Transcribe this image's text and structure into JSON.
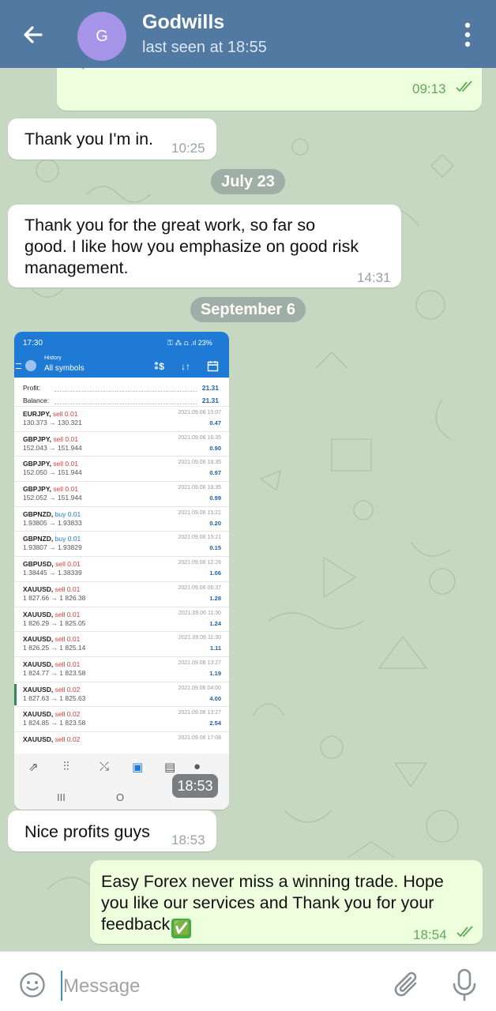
{
  "header": {
    "contact_name": "Godwills",
    "status": "last seen at 18:55",
    "avatar_initial": "G",
    "avatar_color": "#a694e8"
  },
  "messages": [
    {
      "id": "m0",
      "direction": "out",
      "text": "",
      "time": "09:13",
      "read": true
    },
    {
      "id": "m1",
      "direction": "in",
      "text": "Thank you I'm in.",
      "time": "10:25"
    },
    {
      "id": "d1",
      "type": "date",
      "text": "July 23"
    },
    {
      "id": "m2",
      "direction": "in",
      "lines": [
        "Thank you for the great work, so far so",
        "good. I like how you emphasize on good risk",
        "management."
      ],
      "time": "14:31"
    },
    {
      "id": "d2",
      "type": "date",
      "text": "September 6"
    },
    {
      "id": "m3",
      "direction": "in",
      "type": "image",
      "time": "18:53"
    },
    {
      "id": "m4",
      "direction": "in",
      "text": "Nice profits guys",
      "time": "18:53"
    },
    {
      "id": "m5",
      "direction": "out",
      "lines": [
        "Easy Forex never miss a winning trade. Hope",
        "you like our services and Thank you for your",
        "feedback"
      ],
      "emoji": "✅",
      "time": "18:54",
      "read": true
    }
  ],
  "screenshot": {
    "status_time": "17:30",
    "status_right": "⚿ ⁂ ⩍ .ıl 23%",
    "title_small": "History",
    "title": "All symbols",
    "profit_label": "Profit:",
    "profit_value": "21.31",
    "balance_label": "Balance:",
    "balance_value": "21.31",
    "trades": [
      {
        "symbol": "EURJPY,",
        "side": "sell 0.01",
        "type": "sell",
        "prices": "130.373 → 130.321",
        "date": "2021.09.06 15:07",
        "profit": "0.47"
      },
      {
        "symbol": "GBPJPY,",
        "side": "sell 0.01",
        "type": "sell",
        "prices": "152.043 → 151.944",
        "date": "2021.09.06 16:35",
        "profit": "0.90"
      },
      {
        "symbol": "GBPJPY,",
        "side": "sell 0.01",
        "type": "sell",
        "prices": "152.050 → 151.944",
        "date": "2021.09.06 16:35",
        "profit": "0.97"
      },
      {
        "symbol": "GBPJPY,",
        "side": "sell 0.01",
        "type": "sell",
        "prices": "152.052 → 151.944",
        "date": "2021.09.06 16:35",
        "profit": "0.99"
      },
      {
        "symbol": "GBPNZD,",
        "side": "buy 0.01",
        "type": "buy",
        "prices": "1.93805 → 1.93833",
        "date": "2021.09.06 15:21",
        "profit": "0.20"
      },
      {
        "symbol": "GBPNZD,",
        "side": "buy 0.01",
        "type": "buy",
        "prices": "1.93807 → 1.93829",
        "date": "2021.09.06 15:21",
        "profit": "0.15"
      },
      {
        "symbol": "GBPUSD,",
        "side": "sell 0.01",
        "type": "sell",
        "prices": "1.38445 → 1.38339",
        "date": "2021.09.06 12:26",
        "profit": "1.06"
      },
      {
        "symbol": "XAUUSD,",
        "side": "sell 0.01",
        "type": "sell",
        "prices": "1 827.66 → 1 826.38",
        "date": "2021.09.06 06:37",
        "profit": "1.28"
      },
      {
        "symbol": "XAUUSD,",
        "side": "sell 0.01",
        "type": "sell",
        "prices": "1 826.29 → 1 825.05",
        "date": "2021.09.06 11:30",
        "profit": "1.24"
      },
      {
        "symbol": "XAUUSD,",
        "side": "sell 0.01",
        "type": "sell",
        "prices": "1 826.25 → 1 825.14",
        "date": "2021.09.06 11:30",
        "profit": "1.11"
      },
      {
        "symbol": "XAUUSD,",
        "side": "sell 0.01",
        "type": "sell",
        "prices": "1 824.77 → 1 823.58",
        "date": "2021.09.06 13:27",
        "profit": "1.19"
      },
      {
        "symbol": "XAUUSD,",
        "side": "sell 0.02",
        "type": "sell",
        "prices": "1 827.63 → 1 825.63",
        "date": "2021.09.06 04:00",
        "profit": "4.00",
        "marked": true
      },
      {
        "symbol": "XAUUSD,",
        "side": "sell 0.02",
        "type": "sell",
        "prices": "1 824.85 → 1 823.58",
        "date": "2021.09.06 13:27",
        "profit": "2.54"
      },
      {
        "symbol": "XAUUSD,",
        "side": "sell 0.02",
        "type": "sell",
        "prices": "",
        "date": "2021.09.06 17:08",
        "profit": ""
      }
    ],
    "tab_icons": [
      "quotes-icon",
      "chart-icon",
      "trade-icon",
      "history-icon",
      "news-icon",
      "messages-icon"
    ],
    "nav_recent": "III",
    "nav_home": "O"
  },
  "input": {
    "placeholder": "Message"
  },
  "colors": {
    "header_bg": "#5279a1",
    "chat_bg": "#c6d7c2",
    "outgoing_bubble": "#eeffde",
    "outgoing_time": "#5fab59",
    "accent": "#3b8ed6"
  }
}
